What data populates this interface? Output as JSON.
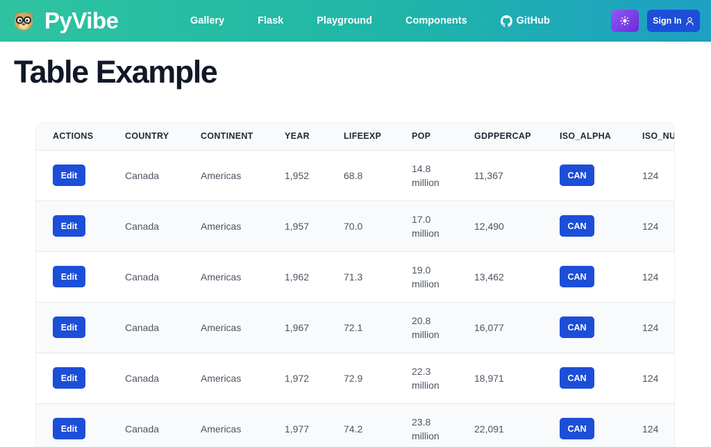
{
  "navbar": {
    "brand": "PyVibe",
    "links": [
      "Gallery",
      "Flask",
      "Playground",
      "Components",
      "GitHub"
    ],
    "signin_label": "Sign In",
    "gradient": [
      "#2ec3a0",
      "#1e9fc4"
    ],
    "theme_button_color": "#7c3aed",
    "primary_color": "#1d4ed8"
  },
  "page": {
    "title": "Table Example"
  },
  "table": {
    "columns": [
      "ACTIONS",
      "COUNTRY",
      "CONTINENT",
      "YEAR",
      "LIFEEXP",
      "POP",
      "GDPPERCAP",
      "ISO_ALPHA",
      "ISO_NU"
    ],
    "edit_label": "Edit",
    "rows": [
      {
        "country": "Canada",
        "continent": "Americas",
        "year": "1,952",
        "lifeexp": "68.8",
        "pop": "14.8 million",
        "gdppercap": "11,367",
        "iso_alpha": "CAN",
        "iso_num": "124"
      },
      {
        "country": "Canada",
        "continent": "Americas",
        "year": "1,957",
        "lifeexp": "70.0",
        "pop": "17.0 million",
        "gdppercap": "12,490",
        "iso_alpha": "CAN",
        "iso_num": "124"
      },
      {
        "country": "Canada",
        "continent": "Americas",
        "year": "1,962",
        "lifeexp": "71.3",
        "pop": "19.0 million",
        "gdppercap": "13,462",
        "iso_alpha": "CAN",
        "iso_num": "124"
      },
      {
        "country": "Canada",
        "continent": "Americas",
        "year": "1,967",
        "lifeexp": "72.1",
        "pop": "20.8 million",
        "gdppercap": "16,077",
        "iso_alpha": "CAN",
        "iso_num": "124"
      },
      {
        "country": "Canada",
        "continent": "Americas",
        "year": "1,972",
        "lifeexp": "72.9",
        "pop": "22.3 million",
        "gdppercap": "18,971",
        "iso_alpha": "CAN",
        "iso_num": "124"
      },
      {
        "country": "Canada",
        "continent": "Americas",
        "year": "1,977",
        "lifeexp": "74.2",
        "pop": "23.8 million",
        "gdppercap": "22,091",
        "iso_alpha": "CAN",
        "iso_num": "124"
      }
    ]
  }
}
